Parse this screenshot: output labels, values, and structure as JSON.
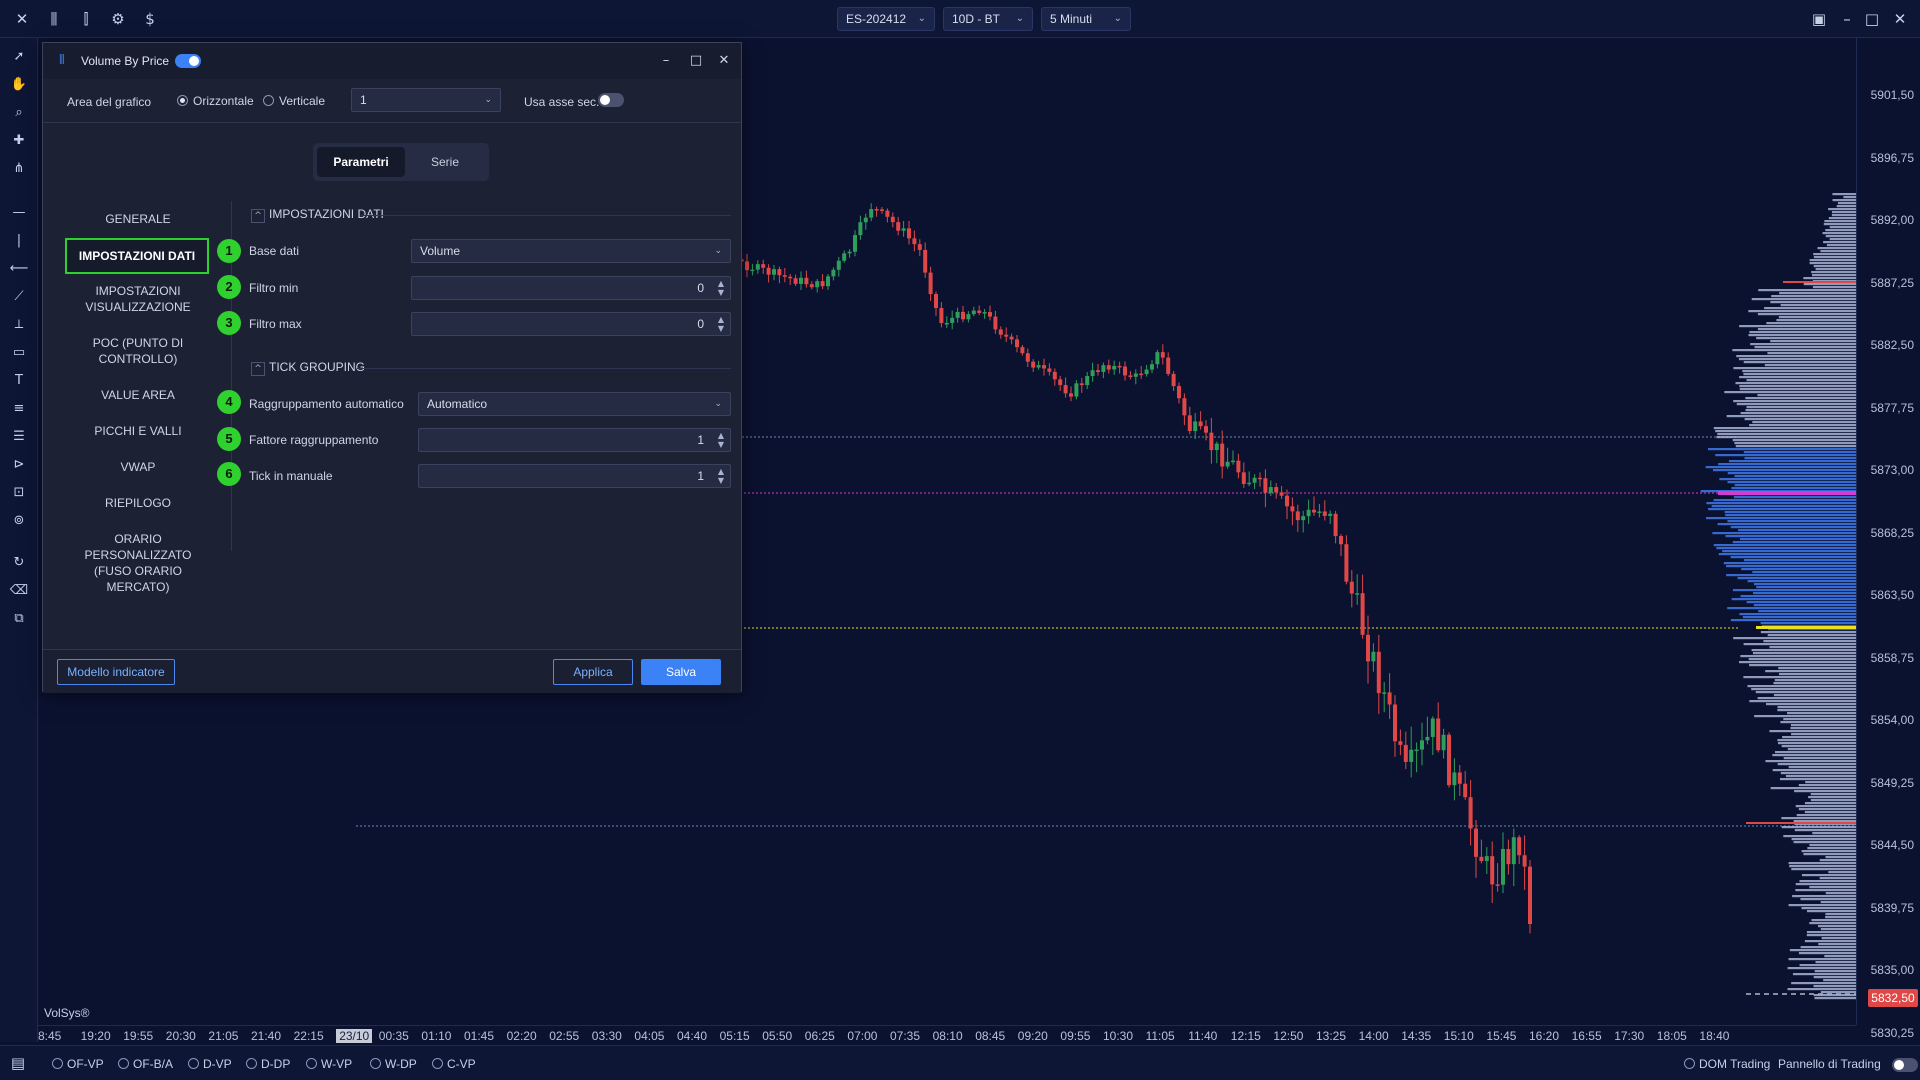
{
  "topbar": {
    "symbol": "ES-202412",
    "range": "10D - BT",
    "timeframe": "5 Minuti"
  },
  "chart": {
    "watermark": "VolSys®",
    "price_labels": [
      "5901,50",
      "5896,75",
      "5892,00",
      "5887,25",
      "5882,50",
      "5877,75",
      "5873,00",
      "5868,25",
      "5863,50",
      "5858,75",
      "5854,00",
      "5849,25",
      "5844,50",
      "5839,75",
      "5835,00",
      "5830,25"
    ],
    "current_price": "5832,50",
    "time_labels": [
      "8:45",
      "19:20",
      "19:55",
      "20:30",
      "21:05",
      "21:40",
      "22:15",
      "23/10",
      "00:35",
      "01:10",
      "01:45",
      "02:20",
      "02:55",
      "03:30",
      "04:05",
      "04:40",
      "05:15",
      "05:50",
      "06:25",
      "07:00",
      "07:35",
      "08:10",
      "08:45",
      "09:20",
      "09:55",
      "10:30",
      "11:05",
      "11:40",
      "12:15",
      "12:50",
      "13:25",
      "14:00",
      "14:35",
      "15:10",
      "15:45",
      "16:20",
      "16:55",
      "17:30",
      "18:05",
      "18:40"
    ],
    "colors": {
      "up": "#2e9e5a",
      "down": "#e04848",
      "poc": "#d43ad4",
      "value_area_low": "#e8e020",
      "profile": "#3b6fd8"
    }
  },
  "bottombar": {
    "modes": [
      "OF-VP",
      "OF-B/A",
      "D-VP",
      "D-DP",
      "W-VP",
      "W-DP",
      "C-VP"
    ],
    "dom_trading": "DOM Trading",
    "trading_panel": "Pannello di Trading"
  },
  "dialog": {
    "title": "Volume By Price",
    "chart_area_label": "Area del grafico",
    "orient_horizontal": "Orizzontale",
    "orient_vertical": "Verticale",
    "area_value": "1",
    "secondary_axis_label": "Usa asse sec.",
    "tabs": {
      "params": "Parametri",
      "series": "Serie"
    },
    "nav": {
      "generale": "GENERALE",
      "impostazioni_dati": "IMPOSTAZIONI DATI",
      "impostazioni_vis": "IMPOSTAZIONI VISUALIZZAZIONE",
      "poc": "POC (PUNTO DI CONTROLLO)",
      "value_area": "VALUE AREA",
      "picchi": "PICCHI E VALLI",
      "vwap": "VWAP",
      "riepilogo": "RIEPILOGO",
      "orario": "ORARIO PERSONALIZZATO (FUSO ORARIO MERCATO)"
    },
    "section_data": "IMPOSTAZIONI DATI",
    "section_tick": "TICK GROUPING",
    "fields": {
      "base_dati": {
        "badge": "1",
        "label": "Base dati",
        "value": "Volume"
      },
      "filtro_min": {
        "badge": "2",
        "label": "Filtro min",
        "value": "0"
      },
      "filtro_max": {
        "badge": "3",
        "label": "Filtro max",
        "value": "0"
      },
      "raggr_auto": {
        "badge": "4",
        "label": "Raggruppamento automatico",
        "value": "Automatico"
      },
      "fattore": {
        "badge": "5",
        "label": "Fattore raggruppamento",
        "value": "1"
      },
      "tick_manuale": {
        "badge": "6",
        "label": "Tick in manuale",
        "value": "1"
      }
    },
    "footer": {
      "template": "Modello indicatore",
      "apply": "Applica",
      "save": "Salva"
    }
  }
}
